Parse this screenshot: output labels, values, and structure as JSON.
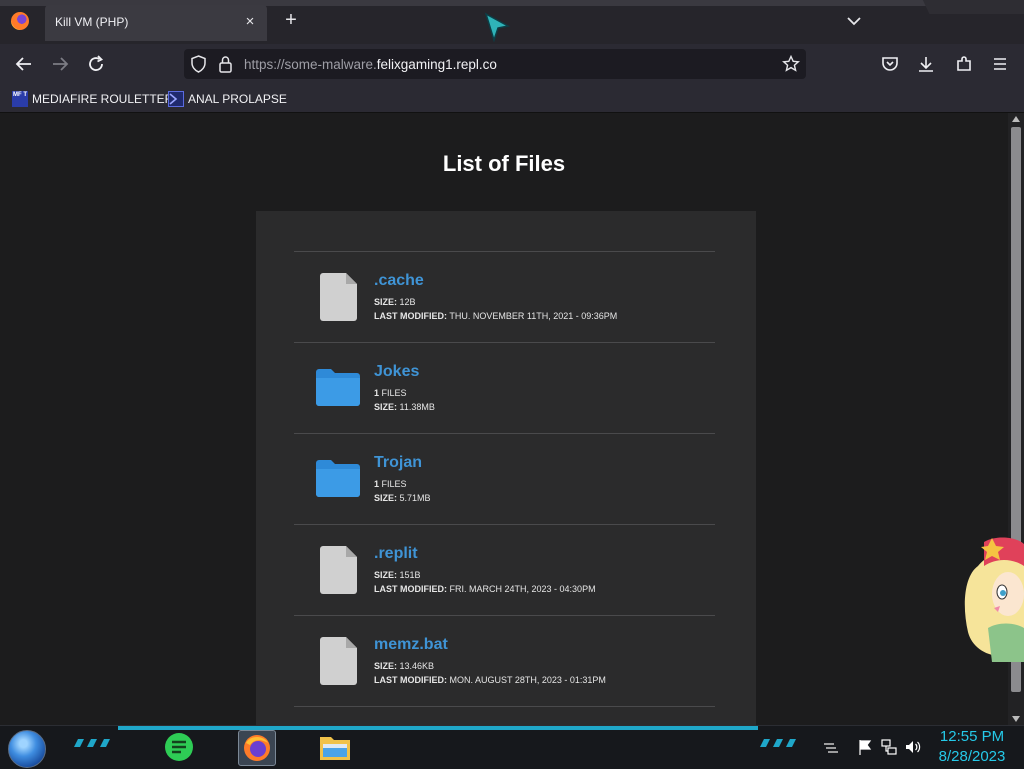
{
  "browser": {
    "tab_title": "Kill VM (PHP)",
    "tab_close": "×",
    "new_tab": "+",
    "url_prefix": "https://some-malware.",
    "url_host": "felixgaming1.repl.co"
  },
  "bookmarks": [
    {
      "label": "MEDIAFIRE ROULETTER",
      "icon_text": "MF T"
    },
    {
      "label": "ANAL PROLAPSE"
    }
  ],
  "page": {
    "title": "List of Files",
    "files": [
      {
        "name": ".cache",
        "type": "file",
        "line1_label": "SIZE:",
        "line1_value": "12B",
        "line2_label": "LAST MODIFIED:",
        "line2_value": "THU. NOVEMBER 11TH, 2021 - 09:36PM"
      },
      {
        "name": "Jokes",
        "type": "folder",
        "line1_label": "1",
        "line1_value": "FILES",
        "line2_label": "SIZE:",
        "line2_value": "11.38MB"
      },
      {
        "name": "Trojan",
        "type": "folder",
        "line1_label": "1",
        "line1_value": "FILES",
        "line2_label": "SIZE:",
        "line2_value": "5.71MB"
      },
      {
        "name": ".replit",
        "type": "file",
        "line1_label": "SIZE:",
        "line1_value": "151B",
        "line2_label": "LAST MODIFIED:",
        "line2_value": "FRI. MARCH 24TH, 2023 - 04:30PM"
      },
      {
        "name": "memz.bat",
        "type": "file",
        "line1_label": "SIZE:",
        "line1_value": "13.46KB",
        "line2_label": "LAST MODIFIED:",
        "line2_value": "MON. AUGUST 28TH, 2023 - 01:31PM"
      }
    ]
  },
  "taskbar": {
    "clock_time": "12:55 PM",
    "clock_date": "8/28/2023"
  },
  "colors": {
    "link": "#3f94d6",
    "panel": "#2b2b2c",
    "folder": "#2e8ad8",
    "file_icon": "#d0d0d0",
    "clock": "#25c9e8"
  }
}
